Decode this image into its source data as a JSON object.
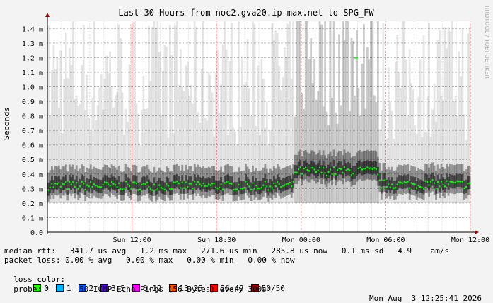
{
  "chart_data": {
    "type": "area",
    "title": "Last 30 Hours from noc2.gva20.ip-max.net to SPG_FW",
    "ylabel": "Seconds",
    "side_label": "RRDTOOL / TOBI OETIKER",
    "ylim": [
      0,
      1.45
    ],
    "y_ticks": [
      "0.0",
      "0.1 m",
      "0.2 m",
      "0.3 m",
      "0.4 m",
      "0.5 m",
      "0.6 m",
      "0.7 m",
      "0.8 m",
      "0.9 m",
      "1.0 m",
      "1.1 m",
      "1.2 m",
      "1.3 m",
      "1.4 m"
    ],
    "y_tick_values": [
      0,
      0.1,
      0.2,
      0.3,
      0.4,
      0.5,
      0.6,
      0.7,
      0.8,
      0.9,
      1.0,
      1.1,
      1.2,
      1.3,
      1.4
    ],
    "xlim_hours": [
      -30,
      0
    ],
    "x_ticks": [
      {
        "label": "Sun 12:00",
        "hour": -24
      },
      {
        "label": "Sun 18:00",
        "hour": -18
      },
      {
        "label": "Mon 00:00",
        "hour": -12
      },
      {
        "label": "Mon 06:00",
        "hour": -6
      },
      {
        "label": "Mon 12:00",
        "hour": 0
      }
    ],
    "median_series": {
      "name": "median rtt",
      "summary": [
        {
          "hour_start": -30,
          "hour_end": -12.5,
          "median": 0.32
        },
        {
          "hour_start": -12.5,
          "hour_end": -6.5,
          "median": 0.42
        },
        {
          "hour_start": -6.5,
          "hour_end": 0,
          "median": 0.33
        }
      ],
      "peak": {
        "hour": -8.1,
        "value": 1.2
      }
    },
    "colors": {
      "background": "#f3f3f3",
      "plot_bg": "#ffffff",
      "grid_minor": "#dcdcdc",
      "grid_major": "#ff9999",
      "median": "#00ff00",
      "smoke": "#000000",
      "axis": "#000000",
      "arrow": "#990000"
    }
  },
  "legend": {
    "median_rtt": "median rtt:   341.7 us avg   1.2 ms max   271.6 us min   285.8 us now   0.1 ms sd   4.9    am/s",
    "packet_loss": "packet loss: 0.00 % avg   0.00 % max   0.00 % min   0.00 % now",
    "loss_color_label": "loss color:",
    "loss_colors": [
      {
        "label": "0",
        "color": "#26ff00"
      },
      {
        "label": "1",
        "color": "#00b8ff"
      },
      {
        "label": "2",
        "color": "#0059ff"
      },
      {
        "label": "3-5",
        "color": "#5e00ff"
      },
      {
        "label": "6-12",
        "color": "#ff00ff"
      },
      {
        "label": "13-25",
        "color": "#ff5500"
      },
      {
        "label": "26-49",
        "color": "#ff0000"
      },
      {
        "label": "50/50",
        "color": "#a10000"
      }
    ],
    "probe": "probe:        50 ICMP Echo Pings (56 Bytes) every 300s",
    "timestamp": "Mon Aug  3 12:25:41 2026"
  }
}
